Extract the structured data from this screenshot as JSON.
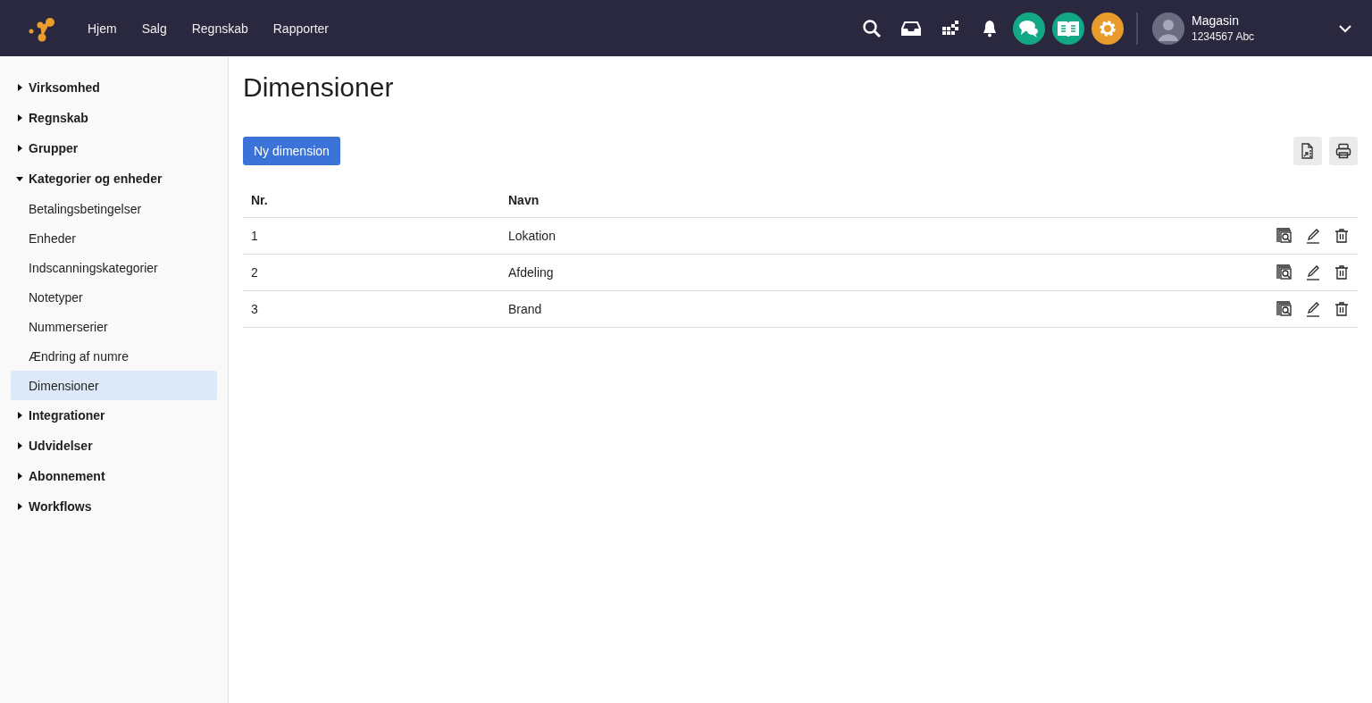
{
  "topbar": {
    "nav": [
      "Hjem",
      "Salg",
      "Regnskab",
      "Rapporter"
    ],
    "user": {
      "name": "Magasin",
      "account": "1234567 Abc"
    }
  },
  "sidebar": {
    "items": [
      {
        "label": "Virksomhed",
        "expanded": false
      },
      {
        "label": "Regnskab",
        "expanded": false
      },
      {
        "label": "Grupper",
        "expanded": false
      },
      {
        "label": "Kategorier og enheder",
        "expanded": true,
        "children": [
          {
            "label": "Betalingsbetingelser",
            "selected": false
          },
          {
            "label": "Enheder",
            "selected": false
          },
          {
            "label": "Indscanningskategorier",
            "selected": false
          },
          {
            "label": "Notetyper",
            "selected": false
          },
          {
            "label": "Nummerserier",
            "selected": false
          },
          {
            "label": "Ændring af numre",
            "selected": false
          },
          {
            "label": "Dimensioner",
            "selected": true
          }
        ]
      },
      {
        "label": "Integrationer",
        "expanded": false
      },
      {
        "label": "Udvidelser",
        "expanded": false
      },
      {
        "label": "Abonnement",
        "expanded": false
      },
      {
        "label": "Workflows",
        "expanded": false
      }
    ]
  },
  "page": {
    "title": "Dimensioner",
    "new_button": "Ny dimension"
  },
  "table": {
    "columns": [
      "Nr.",
      "Navn"
    ],
    "rows": [
      {
        "nr": "1",
        "name": "Lokation"
      },
      {
        "nr": "2",
        "name": "Afdeling"
      },
      {
        "nr": "3",
        "name": "Brand"
      }
    ]
  }
}
